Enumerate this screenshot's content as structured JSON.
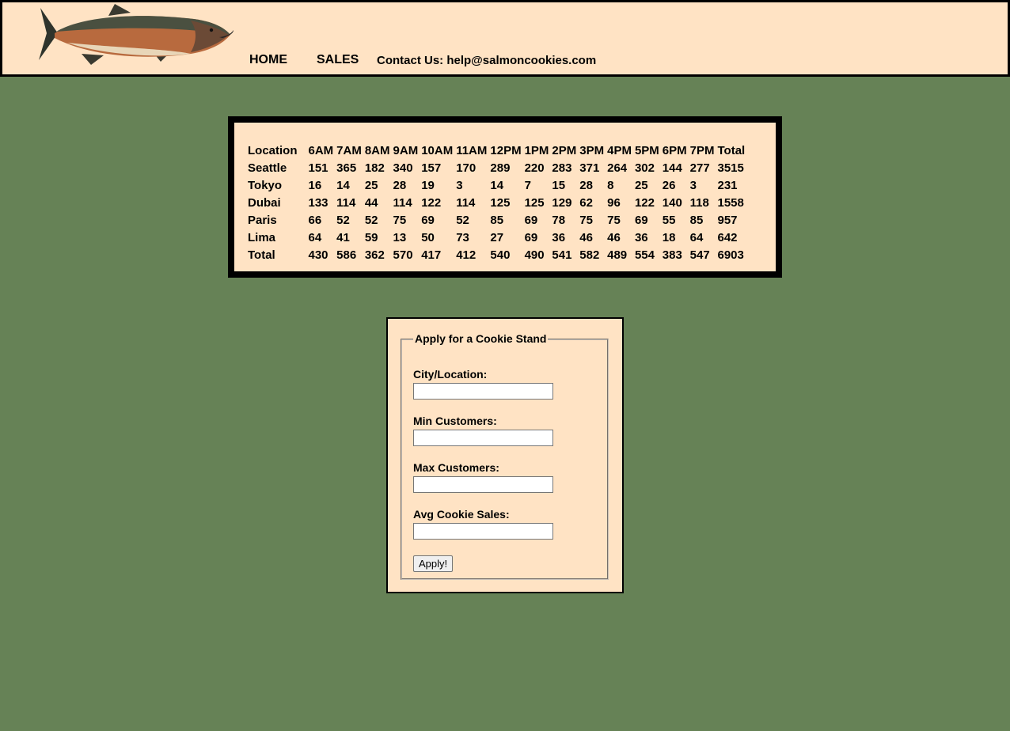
{
  "header": {
    "nav": {
      "home": "HOME",
      "sales": "SALES"
    },
    "contact": "Contact Us: help@salmoncookies.com",
    "logo_icon": "salmon-fish-icon"
  },
  "sales": {
    "header": [
      "Location",
      "6AM",
      "7AM",
      "8AM",
      "9AM",
      "10AM",
      "11AM",
      "12PM",
      "1PM",
      "2PM",
      "3PM",
      "4PM",
      "5PM",
      "6PM",
      "7PM",
      "Total"
    ],
    "rows": [
      [
        "Seattle",
        "151",
        "365",
        "182",
        "340",
        "157",
        "170",
        "289",
        "220",
        "283",
        "371",
        "264",
        "302",
        "144",
        "277",
        "3515"
      ],
      [
        "Tokyo",
        "16",
        "14",
        "25",
        "28",
        "19",
        "3",
        "14",
        "7",
        "15",
        "28",
        "8",
        "25",
        "26",
        "3",
        "231"
      ],
      [
        "Dubai",
        "133",
        "114",
        "44",
        "114",
        "122",
        "114",
        "125",
        "125",
        "129",
        "62",
        "96",
        "122",
        "140",
        "118",
        "1558"
      ],
      [
        "Paris",
        "66",
        "52",
        "52",
        "75",
        "69",
        "52",
        "85",
        "69",
        "78",
        "75",
        "75",
        "69",
        "55",
        "85",
        "957"
      ],
      [
        "Lima",
        "64",
        "41",
        "59",
        "13",
        "50",
        "73",
        "27",
        "69",
        "36",
        "46",
        "46",
        "36",
        "18",
        "64",
        "642"
      ],
      [
        "Total",
        "430",
        "586",
        "362",
        "570",
        "417",
        "412",
        "540",
        "490",
        "541",
        "582",
        "489",
        "554",
        "383",
        "547",
        "6903"
      ]
    ]
  },
  "form": {
    "legend": "Apply for a Cookie Stand",
    "city_label": "City/Location:",
    "city_value": "",
    "min_label": "Min Customers:",
    "min_value": "",
    "max_label": "Max Customers:",
    "max_value": "",
    "avg_label": "Avg Cookie Sales:",
    "avg_value": "",
    "submit_label": "Apply!"
  },
  "colors": {
    "background": "#668256",
    "panel": "#ffe3c4",
    "border": "#000000"
  }
}
